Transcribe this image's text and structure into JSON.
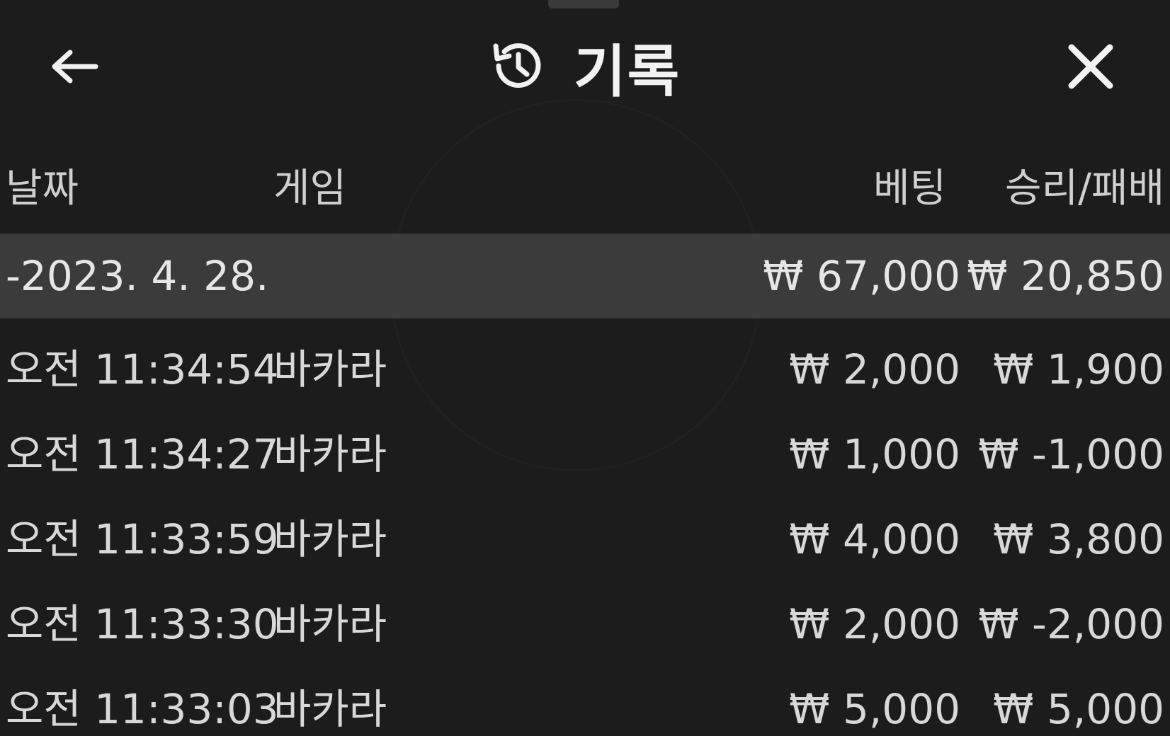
{
  "header": {
    "title": "기록",
    "back_icon": "arrow-left-icon",
    "history_icon": "history-icon",
    "close_icon": "close-icon"
  },
  "columns": {
    "date": "날짜",
    "game": "게임",
    "bet": "베팅",
    "win_loss": "승리/패배"
  },
  "summary": {
    "date": "-2023. 4. 28.",
    "bet": "₩ 67,000",
    "win_loss": "₩ 20,850"
  },
  "rows": [
    {
      "time": "오전 11:34:54",
      "game": "바카라",
      "bet": "₩ 2,000",
      "win_loss": "₩ 1,900"
    },
    {
      "time": "오전 11:34:27",
      "game": "바카라",
      "bet": "₩ 1,000",
      "win_loss": "₩ -1,000"
    },
    {
      "time": "오전 11:33:59",
      "game": "바카라",
      "bet": "₩ 4,000",
      "win_loss": "₩ 3,800"
    },
    {
      "time": "오전 11:33:30",
      "game": "바카라",
      "bet": "₩ 2,000",
      "win_loss": "₩ -2,000"
    },
    {
      "time": "오전 11:33:03",
      "game": "바카라",
      "bet": "₩ 5,000",
      "win_loss": "₩ 5,000"
    }
  ],
  "colors": {
    "background": "#1c1c1c",
    "summary_row": "#3b3b3b",
    "text": "#d8d8d8",
    "title": "#f2f2f2"
  }
}
